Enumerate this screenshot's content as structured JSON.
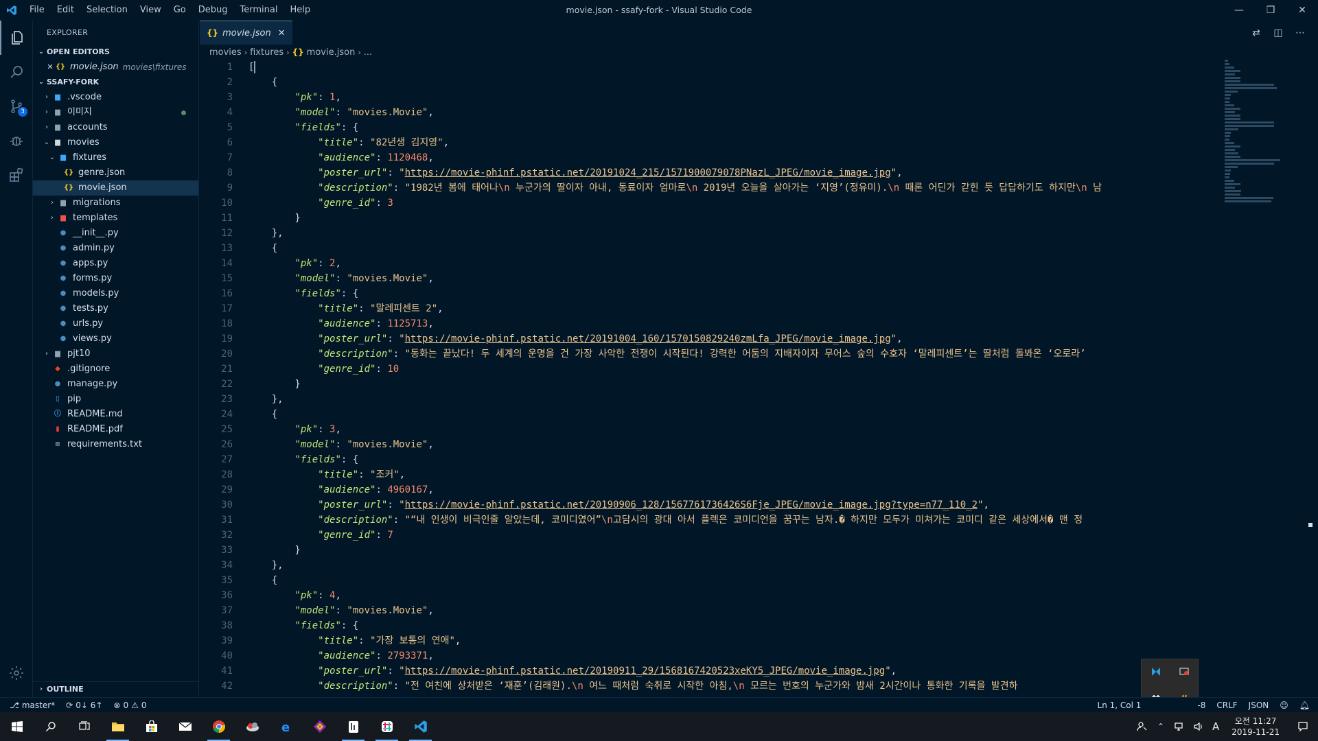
{
  "window": {
    "title": "movie.json - ssafy-fork - Visual Studio Code",
    "menu": [
      "File",
      "Edit",
      "Selection",
      "View",
      "Go",
      "Debug",
      "Terminal",
      "Help"
    ],
    "controls": [
      "minimize",
      "restore",
      "close"
    ]
  },
  "activity": {
    "items": [
      "files-icon",
      "search-icon",
      "source-control-icon",
      "debug-icon",
      "extensions-icon"
    ],
    "scm_badge": "3"
  },
  "sidebar": {
    "title": "EXPLORER",
    "open_editors_label": "OPEN EDITORS",
    "open_editor": {
      "name": "movie.json",
      "path": "movies\\fixtures"
    },
    "project_label": "SSAFY-FORK",
    "tree": [
      {
        "label": ".vscode",
        "type": "folder-blue",
        "depth": 1,
        "twisty": "closed"
      },
      {
        "label": "이미지",
        "type": "folder",
        "depth": 1,
        "twisty": "closed",
        "modified": true
      },
      {
        "label": "accounts",
        "type": "folder",
        "depth": 1,
        "twisty": "closed"
      },
      {
        "label": "movies",
        "type": "folder-open",
        "depth": 1,
        "twisty": "open"
      },
      {
        "label": "fixtures",
        "type": "folder-open-blue",
        "depth": 2,
        "twisty": "open"
      },
      {
        "label": "genre.json",
        "type": "json",
        "depth": 3,
        "twisty": ""
      },
      {
        "label": "movie.json",
        "type": "json",
        "depth": 3,
        "twisty": "",
        "selected": true
      },
      {
        "label": "migrations",
        "type": "folder",
        "depth": 2,
        "twisty": "closed"
      },
      {
        "label": "templates",
        "type": "folder-red",
        "depth": 2,
        "twisty": "closed"
      },
      {
        "label": "__init__.py",
        "type": "python",
        "depth": 2,
        "twisty": ""
      },
      {
        "label": "admin.py",
        "type": "python",
        "depth": 2,
        "twisty": ""
      },
      {
        "label": "apps.py",
        "type": "python",
        "depth": 2,
        "twisty": ""
      },
      {
        "label": "forms.py",
        "type": "python",
        "depth": 2,
        "twisty": ""
      },
      {
        "label": "models.py",
        "type": "python",
        "depth": 2,
        "twisty": ""
      },
      {
        "label": "tests.py",
        "type": "python",
        "depth": 2,
        "twisty": ""
      },
      {
        "label": "urls.py",
        "type": "python",
        "depth": 2,
        "twisty": ""
      },
      {
        "label": "views.py",
        "type": "python",
        "depth": 2,
        "twisty": ""
      },
      {
        "label": "pjt10",
        "type": "folder",
        "depth": 1,
        "twisty": "closed"
      },
      {
        "label": ".gitignore",
        "type": "git",
        "depth": 1,
        "twisty": ""
      },
      {
        "label": "manage.py",
        "type": "python",
        "depth": 1,
        "twisty": ""
      },
      {
        "label": "pip",
        "type": "file",
        "depth": 1,
        "twisty": ""
      },
      {
        "label": "README.md",
        "type": "info",
        "depth": 1,
        "twisty": ""
      },
      {
        "label": "README.pdf",
        "type": "pdf",
        "depth": 1,
        "twisty": ""
      },
      {
        "label": "requirements.txt",
        "type": "text",
        "depth": 1,
        "twisty": ""
      }
    ],
    "outline_label": "OUTLINE"
  },
  "editor": {
    "tab_label": "movie.json",
    "breadcrumb": [
      "movies",
      "fixtures",
      "movie.json",
      "..."
    ],
    "lines": [
      [
        [
          "p",
          "["
        ]
      ],
      [
        [
          "p",
          "    {"
        ]
      ],
      [
        [
          "p",
          "        "
        ],
        [
          "k",
          "\"pk\""
        ],
        [
          "p",
          ": "
        ],
        [
          "n",
          "1"
        ],
        [
          "p",
          ","
        ]
      ],
      [
        [
          "p",
          "        "
        ],
        [
          "k",
          "\"model\""
        ],
        [
          "p",
          ": "
        ],
        [
          "s",
          "\"movies.Movie\""
        ],
        [
          "p",
          ","
        ]
      ],
      [
        [
          "p",
          "        "
        ],
        [
          "k",
          "\"fields\""
        ],
        [
          "p",
          ": {"
        ]
      ],
      [
        [
          "p",
          "            "
        ],
        [
          "k",
          "\"title\""
        ],
        [
          "p",
          ": "
        ],
        [
          "s",
          "\"82년생 김지영\""
        ],
        [
          "p",
          ","
        ]
      ],
      [
        [
          "p",
          "            "
        ],
        [
          "k",
          "\"audience\""
        ],
        [
          "p",
          ": "
        ],
        [
          "n",
          "1120468"
        ],
        [
          "p",
          ","
        ]
      ],
      [
        [
          "p",
          "            "
        ],
        [
          "k",
          "\"poster_url\""
        ],
        [
          "p",
          ": "
        ],
        [
          "s",
          "\""
        ],
        [
          "u",
          "https://movie-phinf.pstatic.net/20191024_215/1571900079078PNazL_JPEG/movie_image.jpg"
        ],
        [
          "s",
          "\""
        ],
        [
          "p",
          ","
        ]
      ],
      [
        [
          "p",
          "            "
        ],
        [
          "k",
          "\"description\""
        ],
        [
          "p",
          ": "
        ],
        [
          "s",
          "\"1982년 봄에 태어나"
        ],
        [
          "e",
          "\\n"
        ],
        [
          "s",
          " 누군가의 딸이자 아내, 동료이자 엄마로"
        ],
        [
          "e",
          "\\n"
        ],
        [
          "s",
          " 2019년 오늘을 살아가는 ‘지영’(정유미)."
        ],
        [
          "e",
          "\\n"
        ],
        [
          "s",
          " 때론 어딘가 갇힌 듯 답답하기도 하지만"
        ],
        [
          "e",
          "\\n"
        ],
        [
          "s",
          " 남"
        ]
      ],
      [
        [
          "p",
          "            "
        ],
        [
          "k",
          "\"genre_id\""
        ],
        [
          "p",
          ": "
        ],
        [
          "n",
          "3"
        ]
      ],
      [
        [
          "p",
          "        }"
        ]
      ],
      [
        [
          "p",
          "    },"
        ]
      ],
      [
        [
          "p",
          "    {"
        ]
      ],
      [
        [
          "p",
          "        "
        ],
        [
          "k",
          "\"pk\""
        ],
        [
          "p",
          ": "
        ],
        [
          "n",
          "2"
        ],
        [
          "p",
          ","
        ]
      ],
      [
        [
          "p",
          "        "
        ],
        [
          "k",
          "\"model\""
        ],
        [
          "p",
          ": "
        ],
        [
          "s",
          "\"movies.Movie\""
        ],
        [
          "p",
          ","
        ]
      ],
      [
        [
          "p",
          "        "
        ],
        [
          "k",
          "\"fields\""
        ],
        [
          "p",
          ": {"
        ]
      ],
      [
        [
          "p",
          "            "
        ],
        [
          "k",
          "\"title\""
        ],
        [
          "p",
          ": "
        ],
        [
          "s",
          "\"말레피센트 2\""
        ],
        [
          "p",
          ","
        ]
      ],
      [
        [
          "p",
          "            "
        ],
        [
          "k",
          "\"audience\""
        ],
        [
          "p",
          ": "
        ],
        [
          "n",
          "1125713"
        ],
        [
          "p",
          ","
        ]
      ],
      [
        [
          "p",
          "            "
        ],
        [
          "k",
          "\"poster_url\""
        ],
        [
          "p",
          ": "
        ],
        [
          "s",
          "\""
        ],
        [
          "u",
          "https://movie-phinf.pstatic.net/20191004_160/1570150829240zmLfa_JPEG/movie_image.jpg"
        ],
        [
          "s",
          "\""
        ],
        [
          "p",
          ","
        ]
      ],
      [
        [
          "p",
          "            "
        ],
        [
          "k",
          "\"description\""
        ],
        [
          "p",
          ": "
        ],
        [
          "s",
          "\"동화는 끝났다! 두 세계의 운명을 건 가장 사악한 전쟁이 시작된다! 강력한 어둠의 지배자이자 무어스 숲의 수호자 ‘말레피센트’는 딸처럼 돌봐온 ‘오로라’"
        ]
      ],
      [
        [
          "p",
          "            "
        ],
        [
          "k",
          "\"genre_id\""
        ],
        [
          "p",
          ": "
        ],
        [
          "n",
          "10"
        ]
      ],
      [
        [
          "p",
          "        }"
        ]
      ],
      [
        [
          "p",
          "    },"
        ]
      ],
      [
        [
          "p",
          "    {"
        ]
      ],
      [
        [
          "p",
          "        "
        ],
        [
          "k",
          "\"pk\""
        ],
        [
          "p",
          ": "
        ],
        [
          "n",
          "3"
        ],
        [
          "p",
          ","
        ]
      ],
      [
        [
          "p",
          "        "
        ],
        [
          "k",
          "\"model\""
        ],
        [
          "p",
          ": "
        ],
        [
          "s",
          "\"movies.Movie\""
        ],
        [
          "p",
          ","
        ]
      ],
      [
        [
          "p",
          "        "
        ],
        [
          "k",
          "\"fields\""
        ],
        [
          "p",
          ": {"
        ]
      ],
      [
        [
          "p",
          "            "
        ],
        [
          "k",
          "\"title\""
        ],
        [
          "p",
          ": "
        ],
        [
          "s",
          "\"조커\""
        ],
        [
          "p",
          ","
        ]
      ],
      [
        [
          "p",
          "            "
        ],
        [
          "k",
          "\"audience\""
        ],
        [
          "p",
          ": "
        ],
        [
          "n",
          "4960167"
        ],
        [
          "p",
          ","
        ]
      ],
      [
        [
          "p",
          "            "
        ],
        [
          "k",
          "\"poster_url\""
        ],
        [
          "p",
          ": "
        ],
        [
          "s",
          "\""
        ],
        [
          "u",
          "https://movie-phinf.pstatic.net/20190906_128/1567761736426S6Fje_JPEG/movie_image.jpg?type=n77_110_2"
        ],
        [
          "s",
          "\""
        ],
        [
          "p",
          ","
        ]
      ],
      [
        [
          "p",
          "            "
        ],
        [
          "k",
          "\"description\""
        ],
        [
          "p",
          ": "
        ],
        [
          "s",
          "\"“내 인생이 비극인줄 알았는데, 코미디였어”"
        ],
        [
          "e",
          "\\n"
        ],
        [
          "s",
          "고담시의 광대 아서 플렉은 코미디언을 꿈꾸는 남자.� 하지만 모두가 미쳐가는 코미디 같은 세상에서� 맨 정"
        ]
      ],
      [
        [
          "p",
          "            "
        ],
        [
          "k",
          "\"genre_id\""
        ],
        [
          "p",
          ": "
        ],
        [
          "n",
          "7"
        ]
      ],
      [
        [
          "p",
          "        }"
        ]
      ],
      [
        [
          "p",
          "    },"
        ]
      ],
      [
        [
          "p",
          "    {"
        ]
      ],
      [
        [
          "p",
          "        "
        ],
        [
          "k",
          "\"pk\""
        ],
        [
          "p",
          ": "
        ],
        [
          "n",
          "4"
        ],
        [
          "p",
          ","
        ]
      ],
      [
        [
          "p",
          "        "
        ],
        [
          "k",
          "\"model\""
        ],
        [
          "p",
          ": "
        ],
        [
          "s",
          "\"movies.Movie\""
        ],
        [
          "p",
          ","
        ]
      ],
      [
        [
          "p",
          "        "
        ],
        [
          "k",
          "\"fields\""
        ],
        [
          "p",
          ": {"
        ]
      ],
      [
        [
          "p",
          "            "
        ],
        [
          "k",
          "\"title\""
        ],
        [
          "p",
          ": "
        ],
        [
          "s",
          "\"가장 보통의 연애\""
        ],
        [
          "p",
          ","
        ]
      ],
      [
        [
          "p",
          "            "
        ],
        [
          "k",
          "\"audience\""
        ],
        [
          "p",
          ": "
        ],
        [
          "n",
          "2793371"
        ],
        [
          "p",
          ","
        ]
      ],
      [
        [
          "p",
          "            "
        ],
        [
          "k",
          "\"poster_url\""
        ],
        [
          "p",
          ": "
        ],
        [
          "s",
          "\""
        ],
        [
          "u",
          "https://movie-phinf.pstatic.net/20190911_29/1568167420523xeKY5_JPEG/movie_image.jpg"
        ],
        [
          "s",
          "\""
        ],
        [
          "p",
          ","
        ]
      ],
      [
        [
          "p",
          "            "
        ],
        [
          "k",
          "\"description\""
        ],
        [
          "p",
          ": "
        ],
        [
          "s",
          "\"전 여친에 상처받은 ‘재훈’(김래원)."
        ],
        [
          "e",
          "\\n"
        ],
        [
          "s",
          " 여느 때처럼 숙취로 시작한 아침,"
        ],
        [
          "e",
          "\\n"
        ],
        [
          "s",
          " 모르는 번호의 누군가와 밤새 2시간이나 통화한 기록을 발견하"
        ]
      ]
    ]
  },
  "statusbar": {
    "branch": "master*",
    "sync": "0↓ 6↑",
    "errors": "0",
    "warnings": "0",
    "position": "Ln 1, Col 1",
    "encoding_partial": "-8",
    "eol": "CRLF",
    "language": "JSON"
  },
  "taskbar": {
    "apps": [
      "windows-start-icon",
      "search-icon",
      "task-view-icon",
      "file-explorer-icon",
      "store-icon",
      "mail-icon",
      "chrome-icon",
      "cloud-app-icon",
      "edge-icon",
      "git-app-icon",
      "notepad-icon",
      "slack-icon",
      "vscode-icon"
    ],
    "ime": "A",
    "clock_time": "오전 11:27",
    "clock_date": "2019-11-21"
  },
  "colors": {
    "background": "#011627",
    "key": "#c5e478",
    "string": "#ecc48d",
    "number": "#f78c6c",
    "json_icon": "#ffca28",
    "python_icon": "#4b8bbe"
  }
}
